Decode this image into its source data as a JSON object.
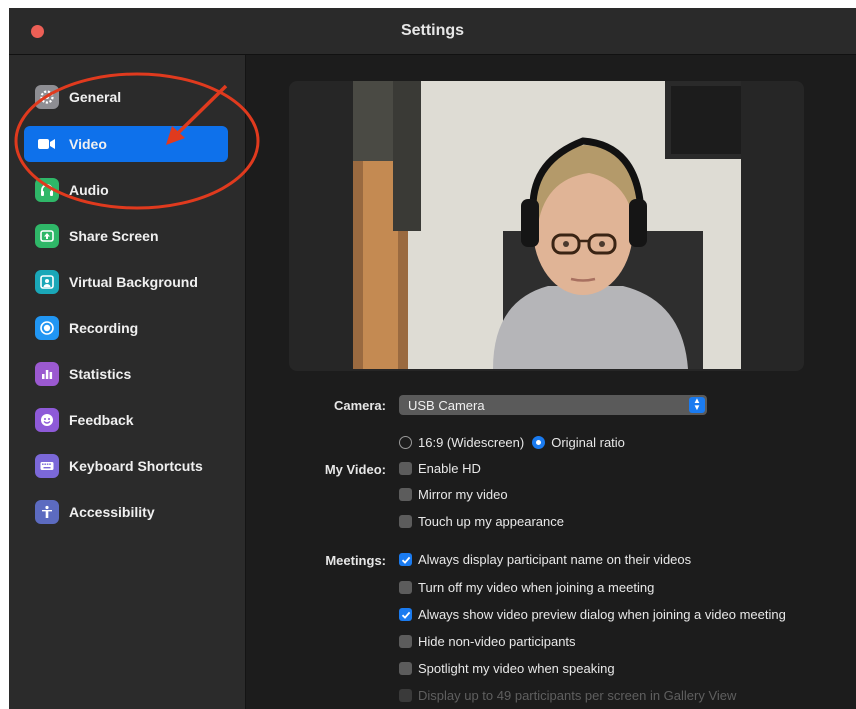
{
  "window": {
    "title": "Settings"
  },
  "sidebar": {
    "items": [
      {
        "label": "General",
        "icon": "gear-icon",
        "color": "#8e8e93"
      },
      {
        "label": "Video",
        "icon": "video-camera-icon",
        "color": "#0e71eb",
        "active": true
      },
      {
        "label": "Audio",
        "icon": "headphones-icon",
        "color": "#2fb768"
      },
      {
        "label": "Share Screen",
        "icon": "share-screen-icon",
        "color": "#2fb768"
      },
      {
        "label": "Virtual Background",
        "icon": "person-background-icon",
        "color": "#1aa7b8"
      },
      {
        "label": "Recording",
        "icon": "record-icon",
        "color": "#2196f3"
      },
      {
        "label": "Statistics",
        "icon": "bar-chart-icon",
        "color": "#9b59d0"
      },
      {
        "label": "Feedback",
        "icon": "smiley-icon",
        "color": "#8e5ad8"
      },
      {
        "label": "Keyboard Shortcuts",
        "icon": "keyboard-icon",
        "color": "#7b68d8"
      },
      {
        "label": "Accessibility",
        "icon": "accessibility-icon",
        "color": "#5c6bc0"
      }
    ]
  },
  "video": {
    "camera_label": "Camera:",
    "camera_value": "USB Camera",
    "aspect_options": [
      {
        "label": "16:9 (Widescreen)",
        "selected": false
      },
      {
        "label": "Original ratio",
        "selected": true
      }
    ],
    "my_video_label": "My Video:",
    "my_video_options": [
      {
        "label": "Enable HD",
        "checked": false
      },
      {
        "label": "Mirror my video",
        "checked": false
      },
      {
        "label": "Touch up my appearance",
        "checked": false
      }
    ],
    "meetings_label": "Meetings:",
    "meetings_options": [
      {
        "label": "Always display participant name on their videos",
        "checked": true
      },
      {
        "label": "Turn off my video when joining a meeting",
        "checked": false
      },
      {
        "label": "Always show video preview dialog when joining a video meeting",
        "checked": true
      },
      {
        "label": "Hide non-video participants",
        "checked": false
      },
      {
        "label": "Spotlight my video when speaking",
        "checked": false
      },
      {
        "label": "Display up to 49 participants per screen in Gallery View",
        "checked": false,
        "disabled": true
      }
    ]
  },
  "colors": {
    "accent": "#0e71eb",
    "close_button": "#ec5f56",
    "annotation": "#e03a1e"
  }
}
